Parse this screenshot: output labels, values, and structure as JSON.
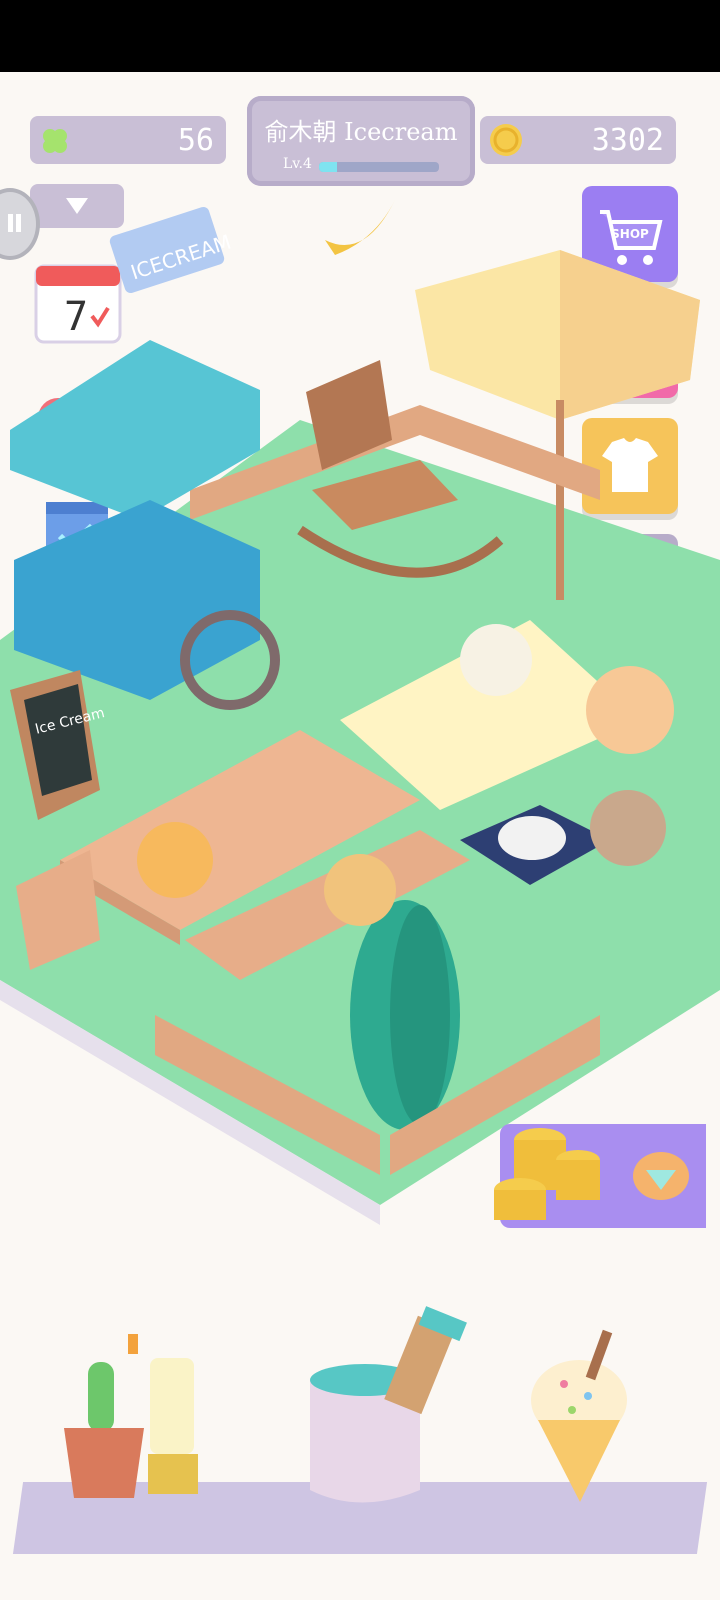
{
  "status_bar": {},
  "hud": {
    "clover_count": "56",
    "coin_count": "3302",
    "shop_title": "俞木朝 Icecream",
    "level_label": "Lv.4",
    "level_progress": 0.15
  },
  "buttons": {
    "shop_label": "SHOP"
  },
  "scene": {
    "cart_sign": "ICECREAM",
    "chalkboard": "Ice Cream",
    "calendar_day": "7"
  },
  "colors": {
    "hud_bg": "#c9bfd6",
    "shop_btn": "#9b7ef2",
    "chest_btn": "#f16aa9",
    "shirt_btn": "#f6c45a",
    "tools_btn": "#b7acc9",
    "lawn": "#8edfab"
  },
  "icons": {
    "clover": "clover-icon",
    "coin": "coin-icon",
    "gem": "gem-icon"
  }
}
